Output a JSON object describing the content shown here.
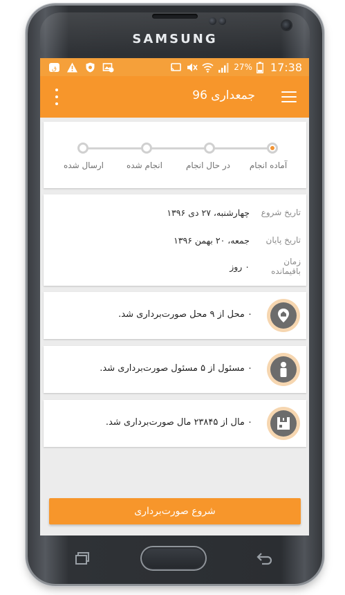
{
  "device": {
    "brand": "SAMSUNG"
  },
  "statusbar": {
    "battery": "27%",
    "time": "17:38"
  },
  "appbar": {
    "title": "جمعداری 96"
  },
  "stepper": {
    "steps": [
      {
        "label": "آماده انجام",
        "active": true
      },
      {
        "label": "در حال انجام",
        "active": false
      },
      {
        "label": "انجام شده",
        "active": false
      },
      {
        "label": "ارسال شده",
        "active": false
      }
    ]
  },
  "info": {
    "start": {
      "label": "تاریخ شروع",
      "value": "چهارشنبه، ۲۷ دی ۱۳۹۶"
    },
    "end": {
      "label": "تاریخ پایان",
      "value": "جمعه، ۲۰ بهمن ۱۳۹۶"
    },
    "remaining": {
      "label": "زمان باقیمانده",
      "value": "۰ روز"
    }
  },
  "stats": [
    {
      "text": "۰ محل از ۹ محل صورت‌برداری شد.",
      "icon": "location-pin-icon"
    },
    {
      "text": "۰ مسئول از ۵ مسئول صورت‌برداری شد.",
      "icon": "person-icon"
    },
    {
      "text": "۰ مال از ۲۳۸۴۵ مال صورت‌برداری شد.",
      "icon": "box-icon"
    }
  ],
  "actions": {
    "start_label": "شروع صورت‌برداری"
  },
  "colors": {
    "accent": "#f7962b",
    "statusbar": "#f5a03a",
    "icon_ring": "#f6d6b0",
    "icon_bg": "#6c6c6c",
    "active_step": "#f29434"
  }
}
